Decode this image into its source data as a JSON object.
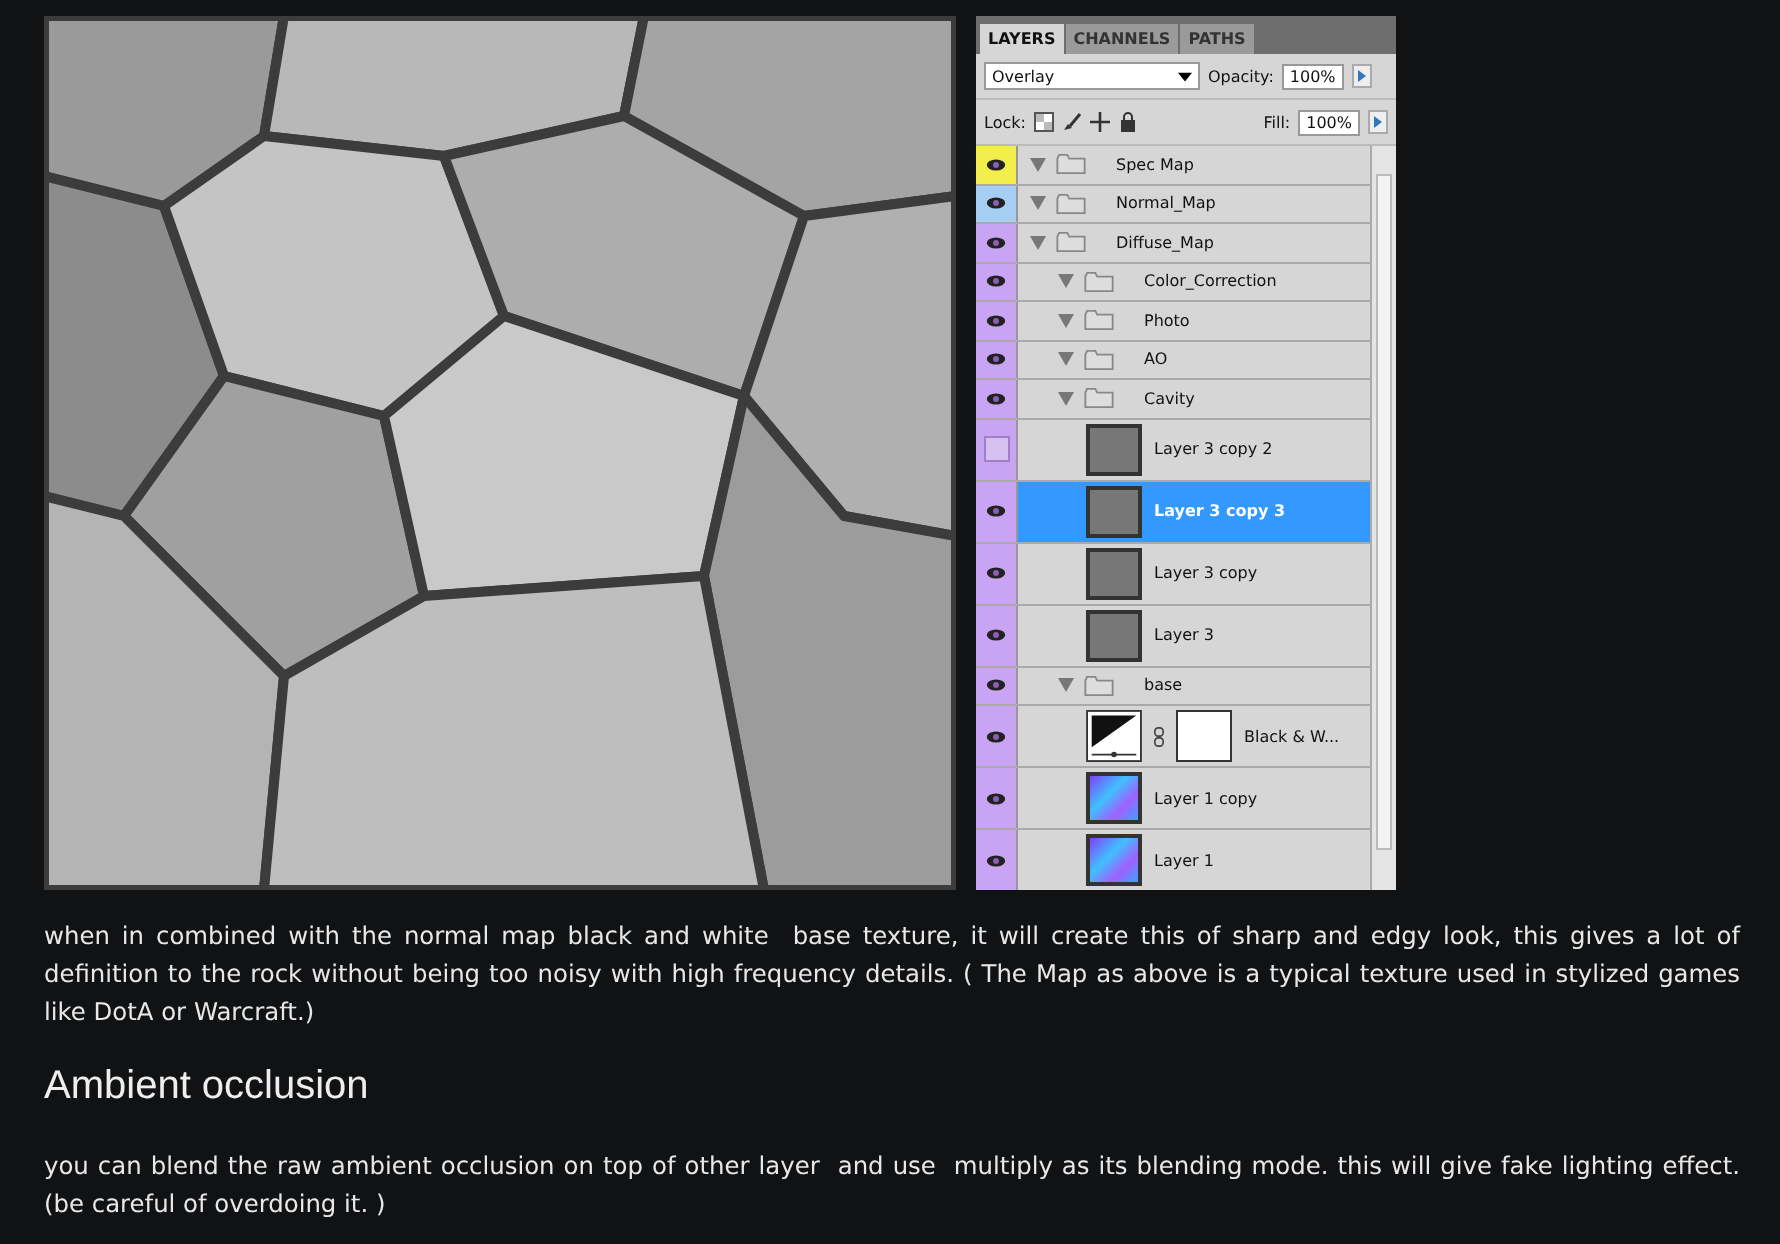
{
  "figure": {
    "layers_panel": {
      "tabs": [
        {
          "label": "LAYERS",
          "selected": true
        },
        {
          "label": "CHANNELS",
          "selected": false
        },
        {
          "label": "PATHS",
          "selected": false
        }
      ],
      "blend_mode": "Overlay",
      "opacity_label": "Opacity:",
      "opacity": "100%",
      "lock_label": "Lock:",
      "fill_label": "Fill:",
      "fill": "100%",
      "layers": [
        {
          "name": "Spec Map",
          "kind": "group",
          "expanded": true,
          "visible": true,
          "selected": false,
          "color": "#f2ee4c"
        },
        {
          "name": "Normal_Map",
          "kind": "group",
          "expanded": true,
          "visible": true,
          "selected": false,
          "color": "#a6cdf2"
        },
        {
          "name": "Diffuse_Map",
          "kind": "group",
          "expanded": true,
          "visible": true,
          "selected": false,
          "color": "#c9a4f4",
          "children": [
            {
              "name": "Color_Correction",
              "kind": "group",
              "expanded": true,
              "visible": true,
              "selected": false,
              "color": "#c9a4f4"
            },
            {
              "name": "Photo",
              "kind": "group",
              "expanded": true,
              "visible": true,
              "selected": false,
              "color": "#c9a4f4"
            },
            {
              "name": "AO",
              "kind": "group",
              "expanded": true,
              "visible": true,
              "selected": false,
              "color": "#c9a4f4"
            },
            {
              "name": "Cavity",
              "kind": "group",
              "expanded": true,
              "visible": true,
              "selected": false,
              "color": "#c9a4f4",
              "children": [
                {
                  "name": "Layer 3 copy 2",
                  "kind": "gray_layer",
                  "visible": false,
                  "selected": false,
                  "color": "#c9a4f4"
                },
                {
                  "name": "Layer 3 copy 3",
                  "kind": "gray_layer",
                  "visible": true,
                  "selected": true,
                  "color": "#c9a4f4"
                },
                {
                  "name": "Layer 3 copy",
                  "kind": "gray_layer",
                  "visible": true,
                  "selected": false,
                  "color": "#c9a4f4"
                },
                {
                  "name": "Layer 3",
                  "kind": "gray_layer",
                  "visible": true,
                  "selected": false,
                  "color": "#c9a4f4"
                }
              ]
            },
            {
              "name": "base",
              "kind": "group",
              "expanded": true,
              "visible": true,
              "selected": false,
              "color": "#c9a4f4",
              "children": [
                {
                  "name": "Black & W...",
                  "kind": "adjustment",
                  "visible": true,
                  "selected": false,
                  "color": "#c9a4f4"
                },
                {
                  "name": "Layer 1 copy",
                  "kind": "normal_layer",
                  "visible": true,
                  "selected": false,
                  "color": "#c9a4f4"
                },
                {
                  "name": "Layer 1",
                  "kind": "normal_layer",
                  "visible": true,
                  "selected": false,
                  "color": "#c9a4f4"
                }
              ]
            }
          ]
        }
      ]
    }
  },
  "paragraph_1": "when in combined with the normal map black and white  base texture, it will create this of sharp and edgy look, this gives a lot of definition to the rock without being too noisy with high frequency details. ( The Map as above is a typical texture used in stylized games like DotA or Warcraft.)",
  "heading": "Ambient occlusion",
  "paragraph_2": "you can blend the raw ambient occlusion on top of other layer  and use  multiply as its blending mode. this will give fake lighting effect. (be careful of overdoing it. )"
}
